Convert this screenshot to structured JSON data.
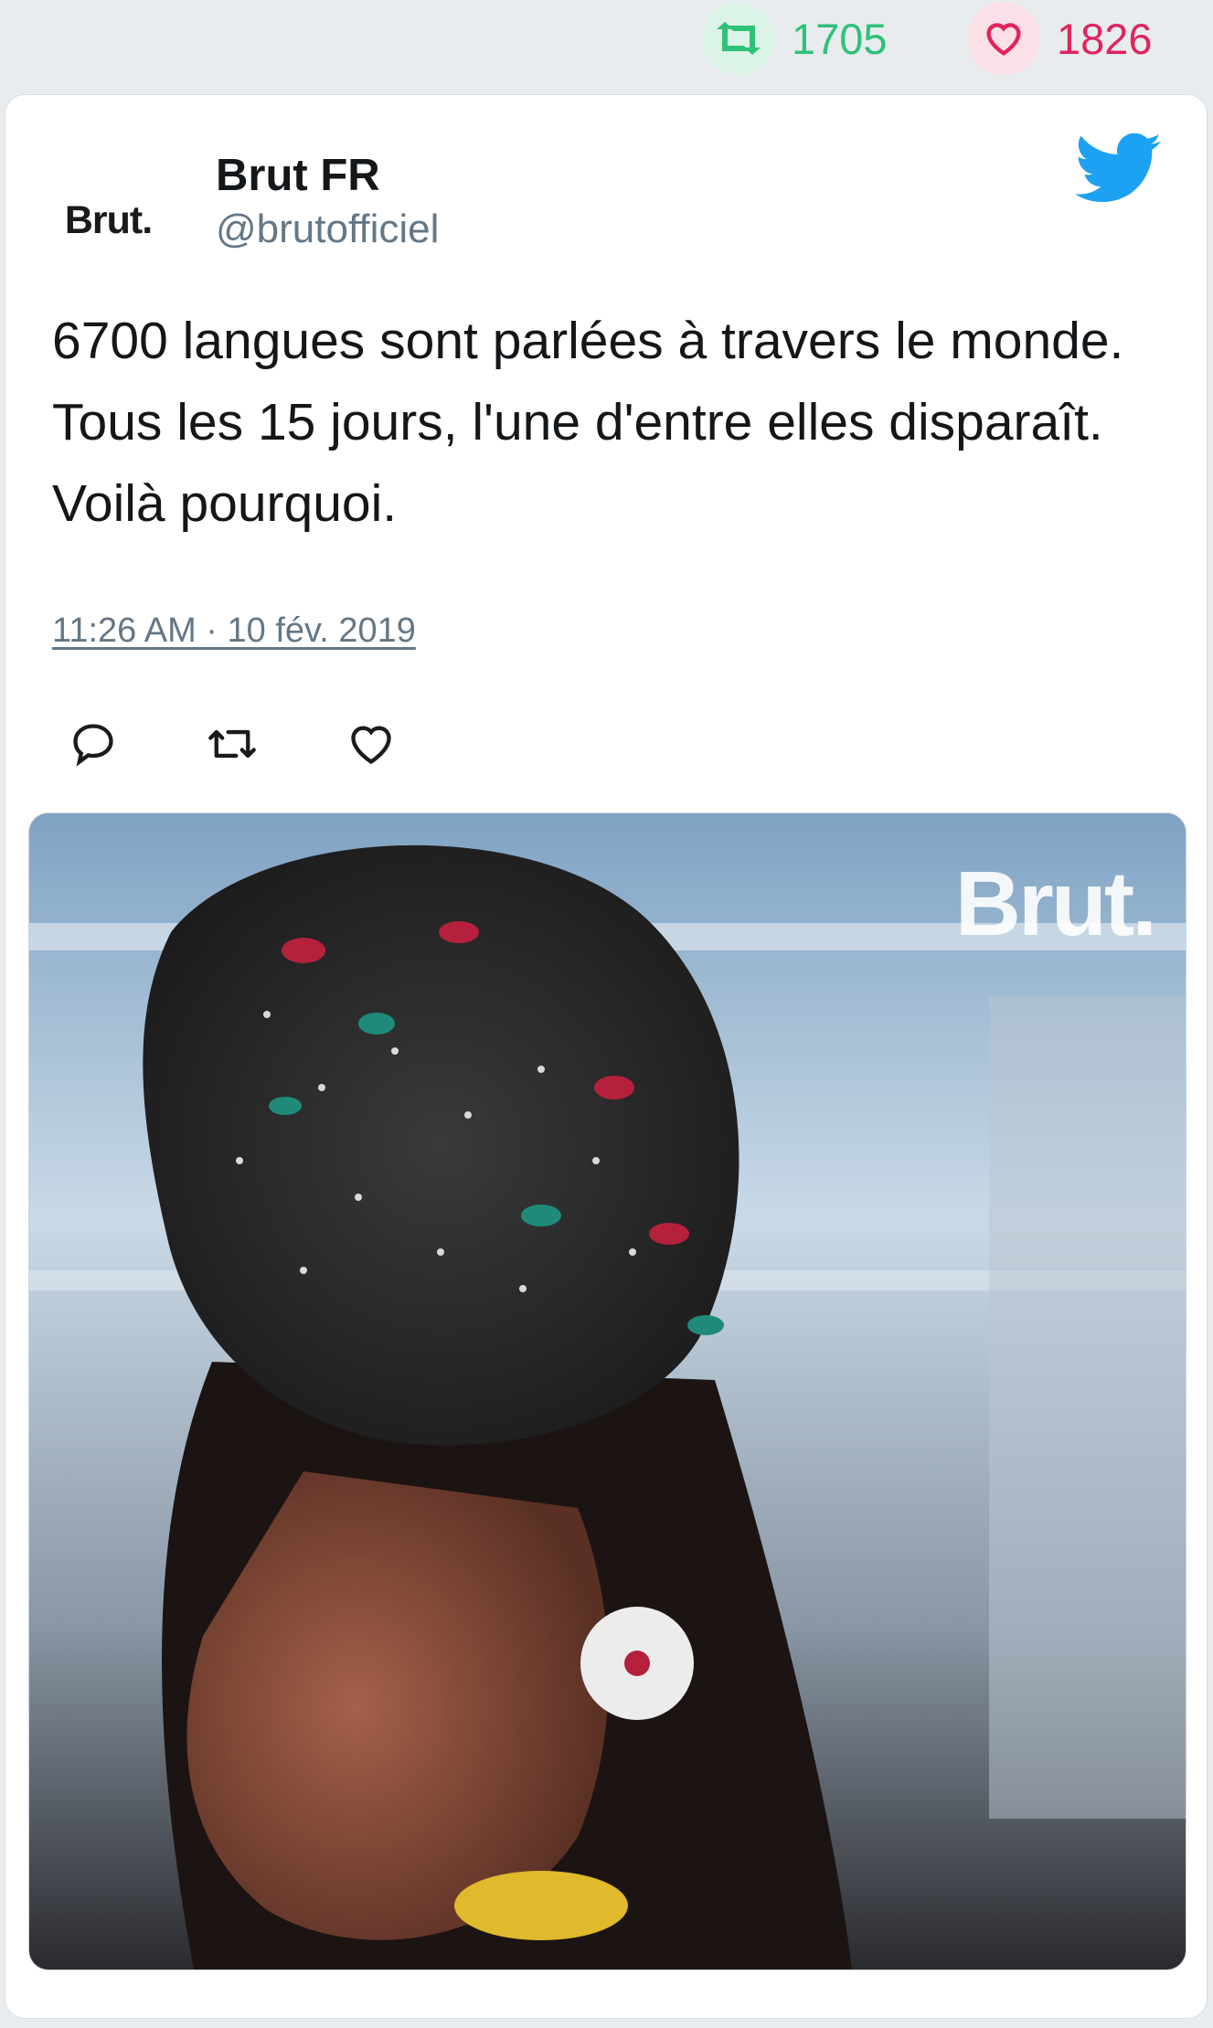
{
  "stats": {
    "retweets": "1705",
    "likes": "1826",
    "retweet_color": "#2fc178",
    "like_color": "#e0245e"
  },
  "tweet": {
    "author_logo_text": "Brut.",
    "author_name": "Brut FR",
    "author_handle": "@brutofficiel",
    "text": "6700 langues sont parlées à travers le monde. Tous les 15 jours, l'une d'entre elles disparaît. Voilà pourquoi.",
    "timestamp": "11:26 AM · 10 fév. 2019",
    "brand_icon": "twitter-bird-icon",
    "brand_color": "#1da1f2"
  },
  "actions": {
    "icons": [
      "reply-icon",
      "retweet-icon",
      "like-icon"
    ]
  },
  "media": {
    "watermark": "Brut."
  }
}
